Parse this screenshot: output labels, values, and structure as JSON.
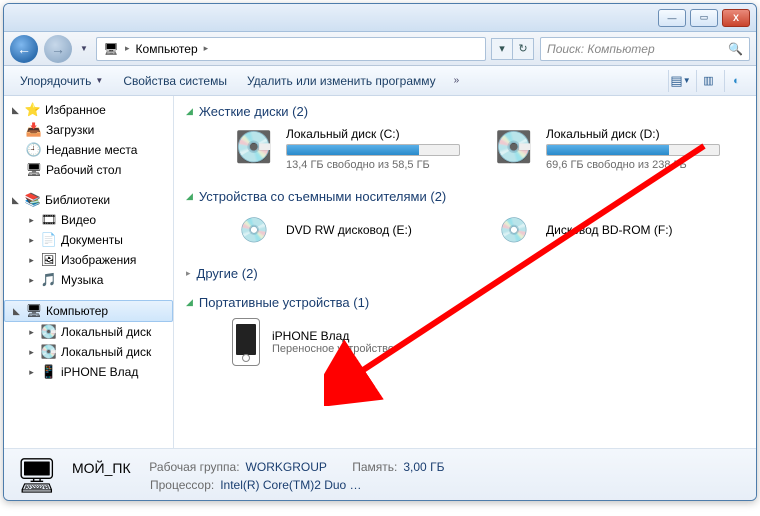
{
  "titlebar": {
    "min": "—",
    "max": "▭",
    "close": "X"
  },
  "nav": {
    "address_icon": "🖥",
    "crumb": "Компьютер",
    "refresh": "↻",
    "dropdown": "▾",
    "search_placeholder": "Поиск: Компьютер"
  },
  "toolbar": {
    "organize": "Упорядочить",
    "properties": "Свойства системы",
    "uninstall": "Удалить или изменить программу",
    "more": "»"
  },
  "sidebar": {
    "fav": "Избранное",
    "fav_items": [
      "Загрузки",
      "Недавние места",
      "Рабочий стол"
    ],
    "lib": "Библиотеки",
    "lib_items": [
      "Видео",
      "Документы",
      "Изображения",
      "Музыка"
    ],
    "computer": "Компьютер",
    "comp_items": [
      "Локальный диск",
      "Локальный диск",
      "iPHONE Влад"
    ]
  },
  "content": {
    "hdd": {
      "title": "Жесткие диски (2)",
      "c": {
        "name": "Локальный диск (C:)",
        "free": "13,4 ГБ свободно из 58,5 ГБ",
        "fill_pct": 77
      },
      "d": {
        "name": "Локальный диск (D:)",
        "free": "69,6 ГБ свободно из 238 ГБ",
        "fill_pct": 71
      }
    },
    "removable": {
      "title": "Устройства со съемными носителями (2)",
      "dvd": "DVD RW дисковод (E:)",
      "bd": "Дисковод BD-ROM (F:)"
    },
    "other": {
      "title": "Другие (2)"
    },
    "portable": {
      "title": "Портативные устройства (1)",
      "name": "iPHONE Влад",
      "sub": "Переносное устройство"
    }
  },
  "status": {
    "name": "МОЙ_ПК",
    "wg_lbl": "Рабочая группа:",
    "wg": "WORKGROUP",
    "mem_lbl": "Память:",
    "mem": "3,00 ГБ",
    "cpu_lbl": "Процессор:",
    "cpu": "Intel(R) Core(TM)2 Duo …"
  }
}
